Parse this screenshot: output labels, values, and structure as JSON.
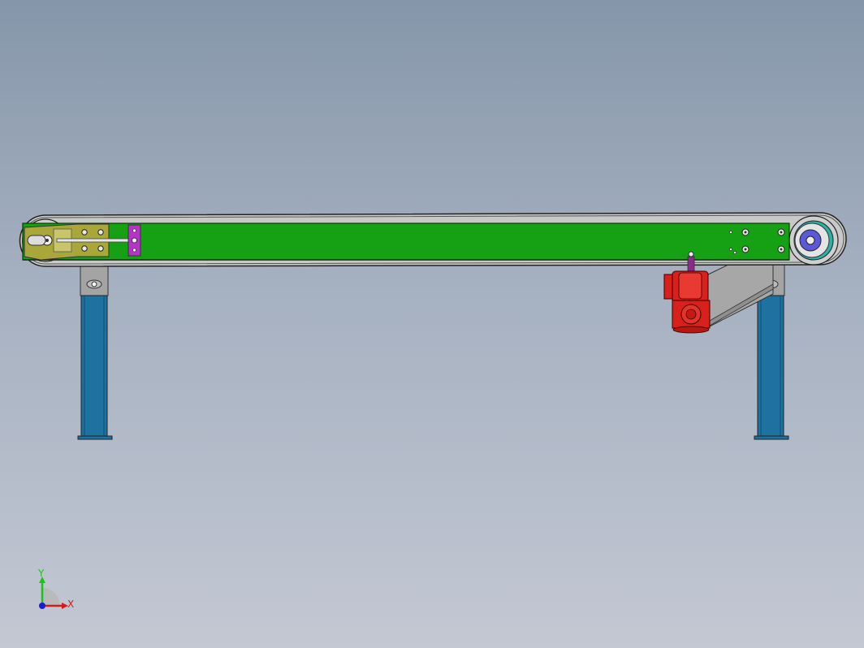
{
  "viewport": {
    "background_top": "#8696aa",
    "background_bottom": "#c3c8d3"
  },
  "model": {
    "parts": [
      "conveyor-frame",
      "conveyor-belt",
      "tail-pulley",
      "drive-pulley",
      "tensioner-plate",
      "tensioner-block",
      "support-leg-left",
      "support-leg-right",
      "gear-motor",
      "motor-mount-bracket"
    ],
    "colors": {
      "frame": "#16a114",
      "tensioner_plate": "#a9a63a",
      "tensioner_block": "#b633c8",
      "leg": "#1e72a0",
      "motor": "#d9201c",
      "drive_hub": "#5a5ad6",
      "bracket": "#a7a7a7"
    }
  },
  "triad": {
    "y_label": "Y",
    "x_label": "X",
    "y_color": "#1cc21c",
    "x_color": "#d41c1c",
    "z_color": "#1c1cd4"
  }
}
